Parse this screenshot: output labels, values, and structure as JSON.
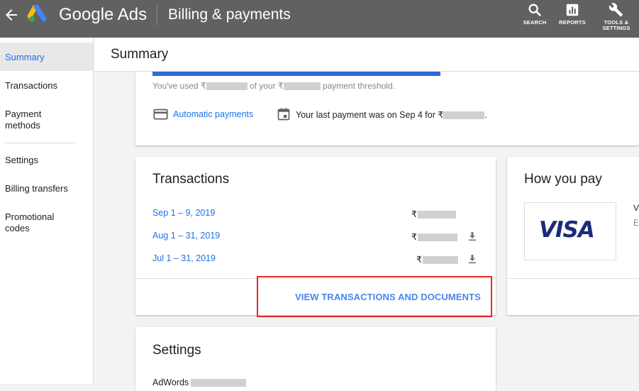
{
  "header": {
    "brand": "Google Ads",
    "page_title": "Billing & payments",
    "actions": [
      {
        "label": "SEARCH",
        "icon": "search-icon"
      },
      {
        "label": "REPORTS",
        "icon": "reports-icon"
      },
      {
        "label_line1": "TOOLS &",
        "label_line2": "SETTINGS",
        "icon": "wrench-icon"
      }
    ]
  },
  "sidebar": {
    "items": [
      {
        "label": "Summary",
        "active": true
      },
      {
        "label": "Transactions"
      },
      {
        "label_line1": "Payment",
        "label_line2": "methods"
      },
      {
        "label": "Settings"
      },
      {
        "label": "Billing transfers"
      },
      {
        "label_line1": "Promotional",
        "label_line2": "codes"
      }
    ]
  },
  "summary": {
    "title": "Summary",
    "threshold_prefix": "You've used ₹",
    "threshold_mid": "of your ₹",
    "threshold_suffix": "payment threshold.",
    "automatic_payments": "Automatic payments",
    "last_payment_prefix": "Your last payment was on Sep 4 for ₹",
    "last_payment_suffix": "."
  },
  "transactions": {
    "title": "Transactions",
    "currency": "₹",
    "rows": [
      {
        "date": "Sep 1 – 9, 2019"
      },
      {
        "date": "Aug 1 – 31, 2019"
      },
      {
        "date": "Jul 1 – 31, 2019"
      }
    ],
    "view_link": "VIEW TRANSACTIONS AND DOCUMENTS"
  },
  "how_you_pay": {
    "title": "How you pay",
    "card_brand": "VISA",
    "partial_line1": "V",
    "partial_line2": "E:"
  },
  "settings": {
    "title": "Settings",
    "adwords_label": "AdWords"
  },
  "colors": {
    "header_bg": "#616161",
    "accent_blue": "#1a73e8",
    "highlight_red": "#e52a2a",
    "visa_navy": "#1a2c78"
  }
}
